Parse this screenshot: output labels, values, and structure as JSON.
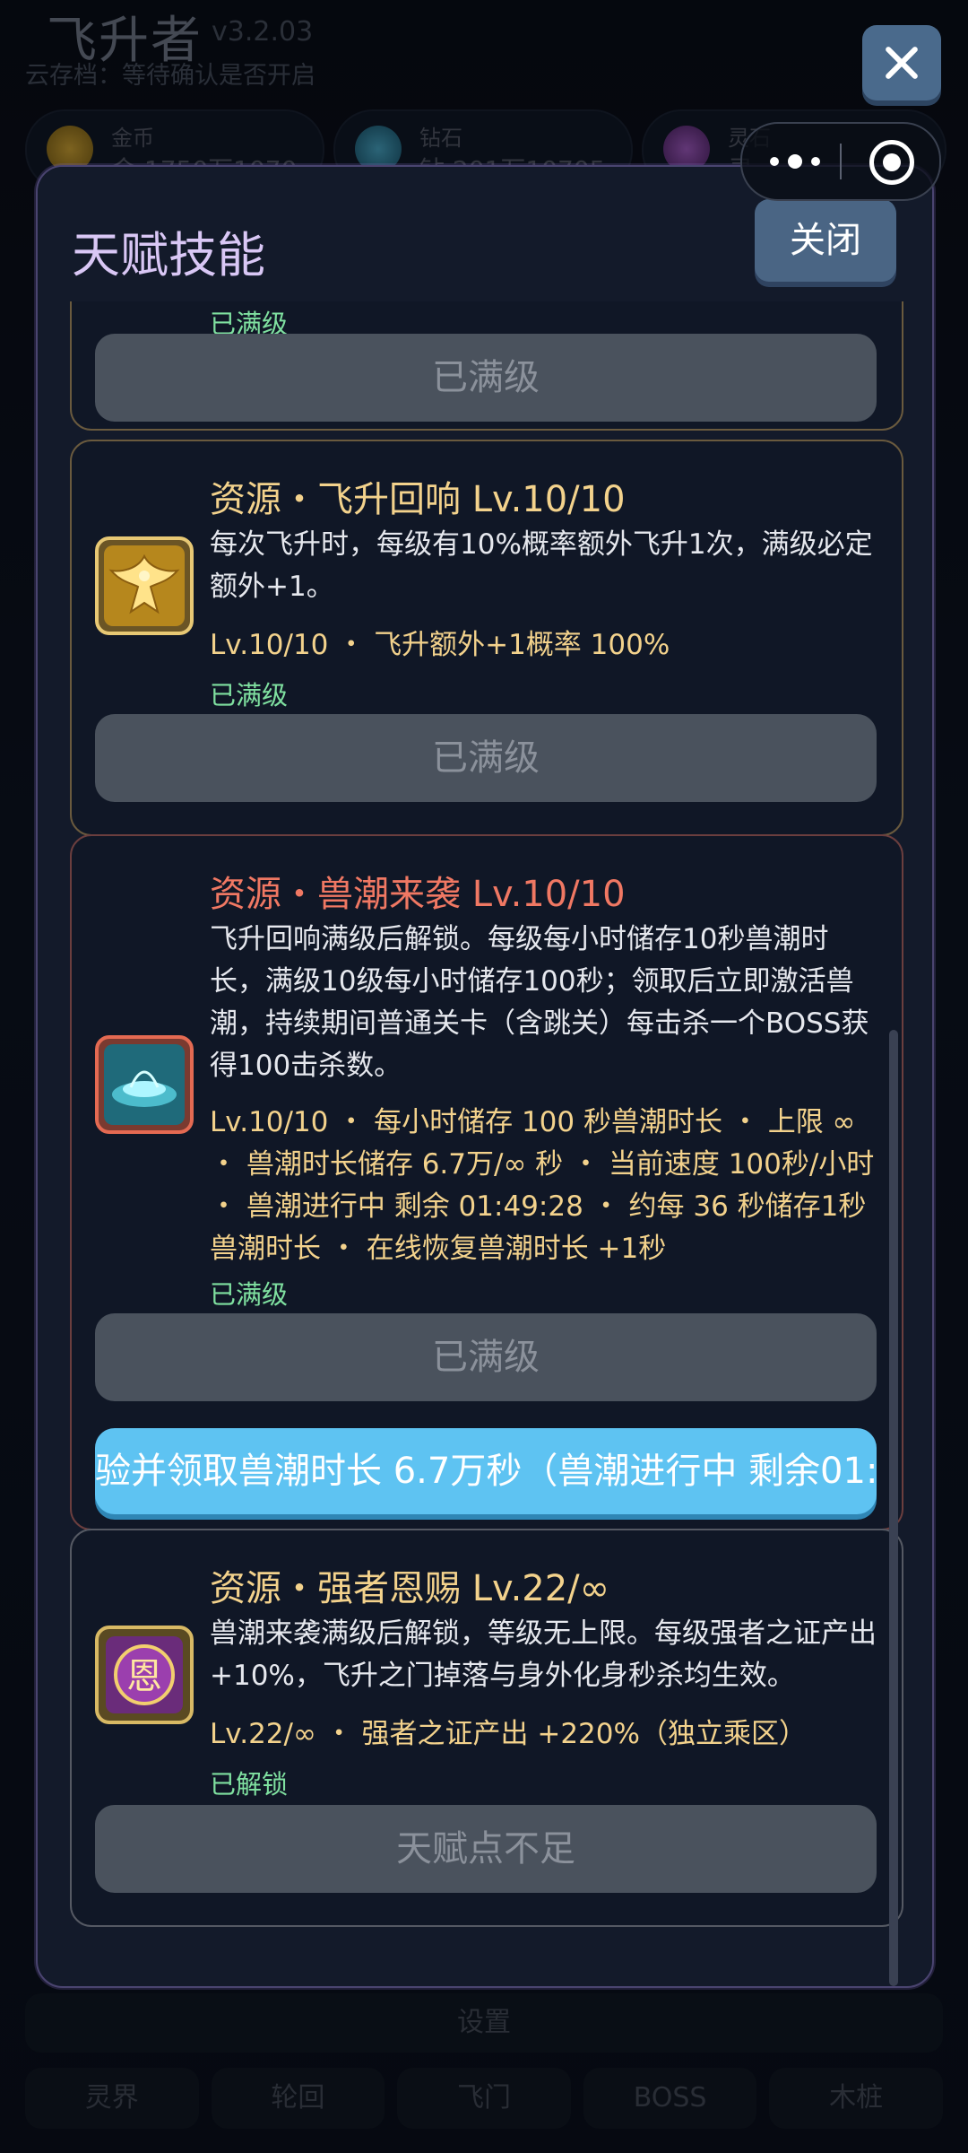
{
  "background": {
    "app_title": "飞升者",
    "version": "v3.2.03",
    "cloud_status": "云存档：等待确认是否开启",
    "resources": [
      {
        "label": "金币",
        "value": "金 1750万1070"
      },
      {
        "label": "钻石",
        "value": "钻 201万10705"
      },
      {
        "label": "灵石",
        "value": "灵"
      }
    ],
    "settings_label": "设置",
    "tabs": [
      "灵界",
      "轮回",
      "飞门",
      "BOSS",
      "木桩"
    ]
  },
  "modal": {
    "title": "天赋技能",
    "close_label": "关闭",
    "top_card": {
      "status": "已满级",
      "button": "已满级"
    },
    "skills": [
      {
        "title": "资源・飞升回响 Lv.10/10",
        "desc": "每次飞升时，每级有10%概率额外飞升1次，满级必定额外+1。",
        "stats": "Lv.10/10 ・ 飞升额外+1概率 100%",
        "status": "已满级",
        "button": "已满级",
        "icon": "phoenix-icon"
      },
      {
        "title": "资源・兽潮来袭 Lv.10/10",
        "desc": "飞升回响满级后解锁。每级每小时储存10秒兽潮时长，满级10级每小时储存100秒；领取后立即激活兽潮，持续期间普通关卡（含跳关）每击杀一个BOSS获得100击杀数。",
        "stats": "Lv.10/10 ・ 每小时储存 100 秒兽潮时长 ・ 上限 ∞ ・ 兽潮时长储存 6.7万/∞ 秒 ・ 当前速度 100秒/小时 ・ 兽潮进行中 剩余 01:49:28 ・ 约每 36 秒储存1秒兽潮时长 ・ 在线恢复兽潮时长 +1秒",
        "status": "已满级",
        "button": "已满级",
        "action_button": "验并领取兽潮时长 6.7万秒（兽潮进行中 剩余01:",
        "icon": "portal-icon"
      },
      {
        "title": "资源・强者恩赐 Lv.22/∞",
        "desc": "兽潮来袭满级后解锁，等级无上限。每级强者之证产出 +10%，飞升之门掉落与身外化身秒杀均生效。",
        "stats": "Lv.22/∞ ・ 强者之证产出 +220%（独立乘区）",
        "status": "已解锁",
        "button": "天赋点不足",
        "icon": "grace-icon",
        "icon_text": "恩"
      }
    ]
  },
  "colors": {
    "title_gold": "#f3d28c",
    "title_red": "#f07863",
    "status_green": "#7fe0a0",
    "action_blue": "#5ec3f2",
    "disabled_gray": "#4a525d"
  }
}
